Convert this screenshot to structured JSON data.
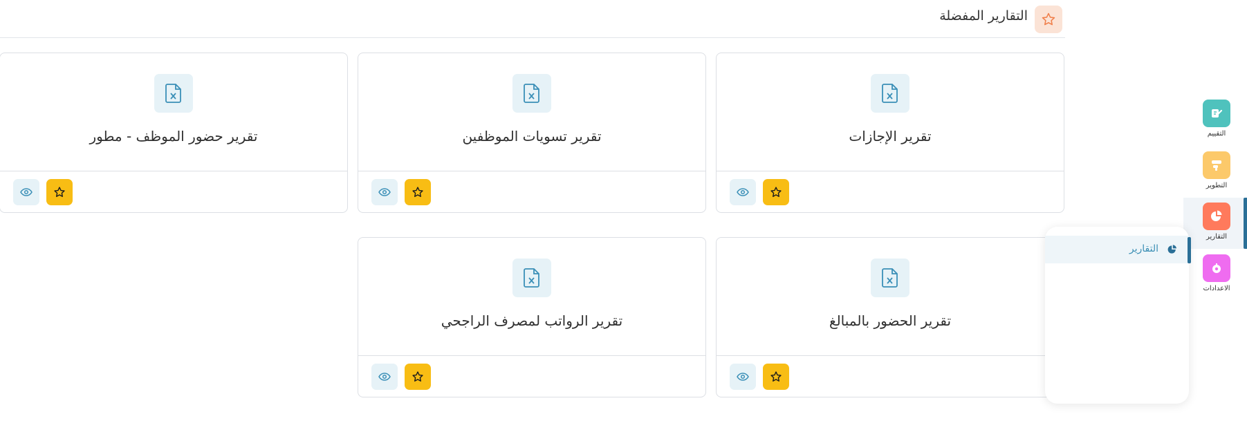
{
  "header": {
    "title": "التقارير المفضلة",
    "icon": "star-icon",
    "icon_bg": "#fbe3d6"
  },
  "cards": [
    {
      "title": "تقرير الإجازات",
      "icon": "excel-file-icon"
    },
    {
      "title": "تقرير تسويات الموظفين",
      "icon": "excel-file-icon"
    },
    {
      "title": "تقرير حضور الموظف - مطور",
      "icon": "excel-file-icon"
    },
    {
      "title": "تقرير الحضور بالمبالغ",
      "icon": "excel-file-icon"
    },
    {
      "title": "تقرير الرواتب لمصرف الراجحي",
      "icon": "excel-file-icon"
    }
  ],
  "card_actions": {
    "view_icon": "eye-icon",
    "favorite_icon": "star-icon",
    "favorite_color": "#f8bd14"
  },
  "rail": [
    {
      "label": "التقييم",
      "icon": "evaluation-icon",
      "color": "#4fc2bd"
    },
    {
      "label": "التطوير",
      "icon": "development-icon",
      "color": "#fcc96a"
    },
    {
      "label": "التقارير",
      "icon": "pie-chart-icon",
      "color": "#ff7a5c",
      "active": true
    },
    {
      "label": "الاعدادات",
      "icon": "settings-icon",
      "color": "#ef6cf0"
    }
  ],
  "flyout": {
    "items": [
      {
        "label": "التقارير",
        "icon": "pie-chart-icon",
        "active": true
      }
    ]
  },
  "colors": {
    "accent": "#2a6f97",
    "light_blue": "#e6f2f7",
    "border": "#dcdfe4"
  }
}
